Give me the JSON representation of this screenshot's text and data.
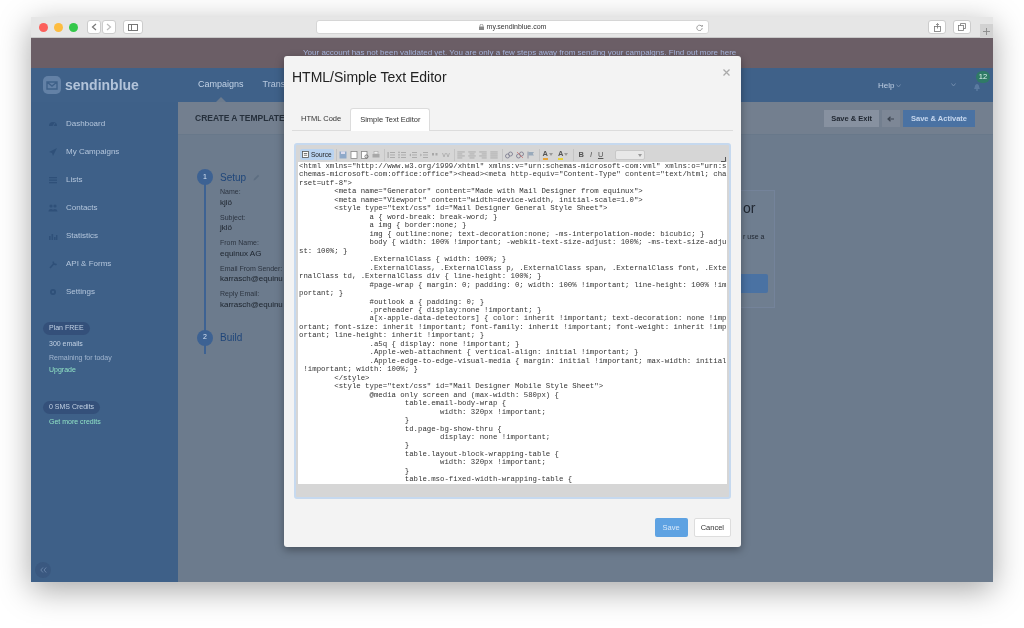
{
  "browser": {
    "url": "my.sendinblue.com"
  },
  "banner": {
    "text": "Your account has not been validated yet. You are only a few steps away from sending your campaigns. Find out more here"
  },
  "header": {
    "logo": "sendinblue",
    "nav": [
      {
        "label": "Campaigns",
        "selected": true
      },
      {
        "label": "Trans",
        "selected": false
      }
    ],
    "help": "Help",
    "notification_count": "12"
  },
  "sidebar": {
    "items": [
      "Dashboard",
      "My Campaigns",
      "Lists",
      "Contacts",
      "Statistics",
      "API & Forms",
      "Settings"
    ],
    "plan": {
      "badge": "Plan FREE",
      "emails": "300 emails",
      "remaining": "Remaining for today",
      "upgrade": "Upgrade"
    },
    "sms": {
      "badge": "0 SMS Credits",
      "link": "Get more credits"
    }
  },
  "page": {
    "title": "CREATE A TEMPLATE",
    "buttons": [
      "Save & Exit",
      "Save & Activate"
    ],
    "steps": [
      {
        "number": "1",
        "title": "Setup",
        "fields": [
          {
            "label": "Name:",
            "value": "kjlö"
          },
          {
            "label": "Subject:",
            "value": "jklö"
          },
          {
            "label": "From Name:",
            "value": "equinux AG"
          },
          {
            "label": "Email From Sender:",
            "value": "karrasch@equinu"
          },
          {
            "label": "Reply Email:",
            "value": "karrasch@equinu"
          }
        ]
      },
      {
        "number": "2",
        "title": "Build"
      }
    ],
    "card": {
      "heading": "or",
      "text": "r use a"
    }
  },
  "modal": {
    "title": "HTML/Simple Text Editor",
    "tabs": [
      {
        "label": "HTML Code",
        "selected": false
      },
      {
        "label": "Simple Text Editor",
        "selected": true
      }
    ],
    "source_button": "Source",
    "color_buttons": [
      "A",
      "A"
    ],
    "format_buttons": [
      "B",
      "I",
      "U"
    ],
    "code_lines": [
      "<html xmlns=\"http://www.w3.org/1999/xhtml\" xmlns:v=\"urn:schemas-microsoft-com:vml\" xmlns:o=\"urn:s",
      "chemas-microsoft-com:office:office\"><head><meta http-equiv=\"Content-Type\" content=\"text/html; cha",
      "rset=utf-8\">",
      "        <meta name=\"Generator\" content=\"Made with Mail Designer from equinux\">",
      "        <meta name=\"Viewport\" content=\"width=device-width, initial-scale=1.0\">",
      "        <style type=\"text/css\" id=\"Mail Designer General Style Sheet\">",
      "                a { word-break: break-word; }",
      "                a img { border:none; }",
      "                img { outline:none; text-decoration:none; -ms-interpolation-mode: bicubic; }",
      "                body { width: 100% !important; -webkit-text-size-adjust: 100%; -ms-text-size-adju",
      "st: 100%; }",
      "                .ExternalClass { width: 100%; }",
      "                .ExternalClass, .ExternalClass p, .ExternalClass span, .ExternalClass font, .Exte",
      "rnalClass td, .ExternalClass div { line-height: 100%; }",
      "                #page-wrap { margin: 0; padding: 0; width: 100% !important; line-height: 100% !im",
      "portant; }",
      "                #outlook a { padding: 0; }",
      "                .preheader { display:none !important; }",
      "                a[x-apple-data-detectors] { color: inherit !important; text-decoration: none !imp",
      "ortant; font-size: inherit !important; font-family: inherit !important; font-weight: inherit !imp",
      "ortant; line-height: inherit !important; }",
      "                .a5q { display: none !important; }",
      "                .Apple-web-attachment { vertical-align: initial !important; }",
      "                .Apple-edge-to-edge-visual-media { margin: initial !important; max-width: initial",
      " !important; width: 100%; }",
      "        </style>",
      "        <style type=\"text/css\" id=\"Mail Designer Mobile Style Sheet\">",
      "                @media only screen and (max-width: 580px) {",
      "                        table.email-body-wrap {",
      "                                width: 320px !important;",
      "                        }",
      "                        td.page-bg-show-thru {",
      "                                display: none !important;",
      "                        }",
      "                        table.layout-block-wrapping-table {",
      "                                width: 320px !important;",
      "                        }",
      "                        table.mso-fixed-width-wrapping-table {"
    ],
    "buttons": [
      "Save",
      "Cancel"
    ]
  }
}
